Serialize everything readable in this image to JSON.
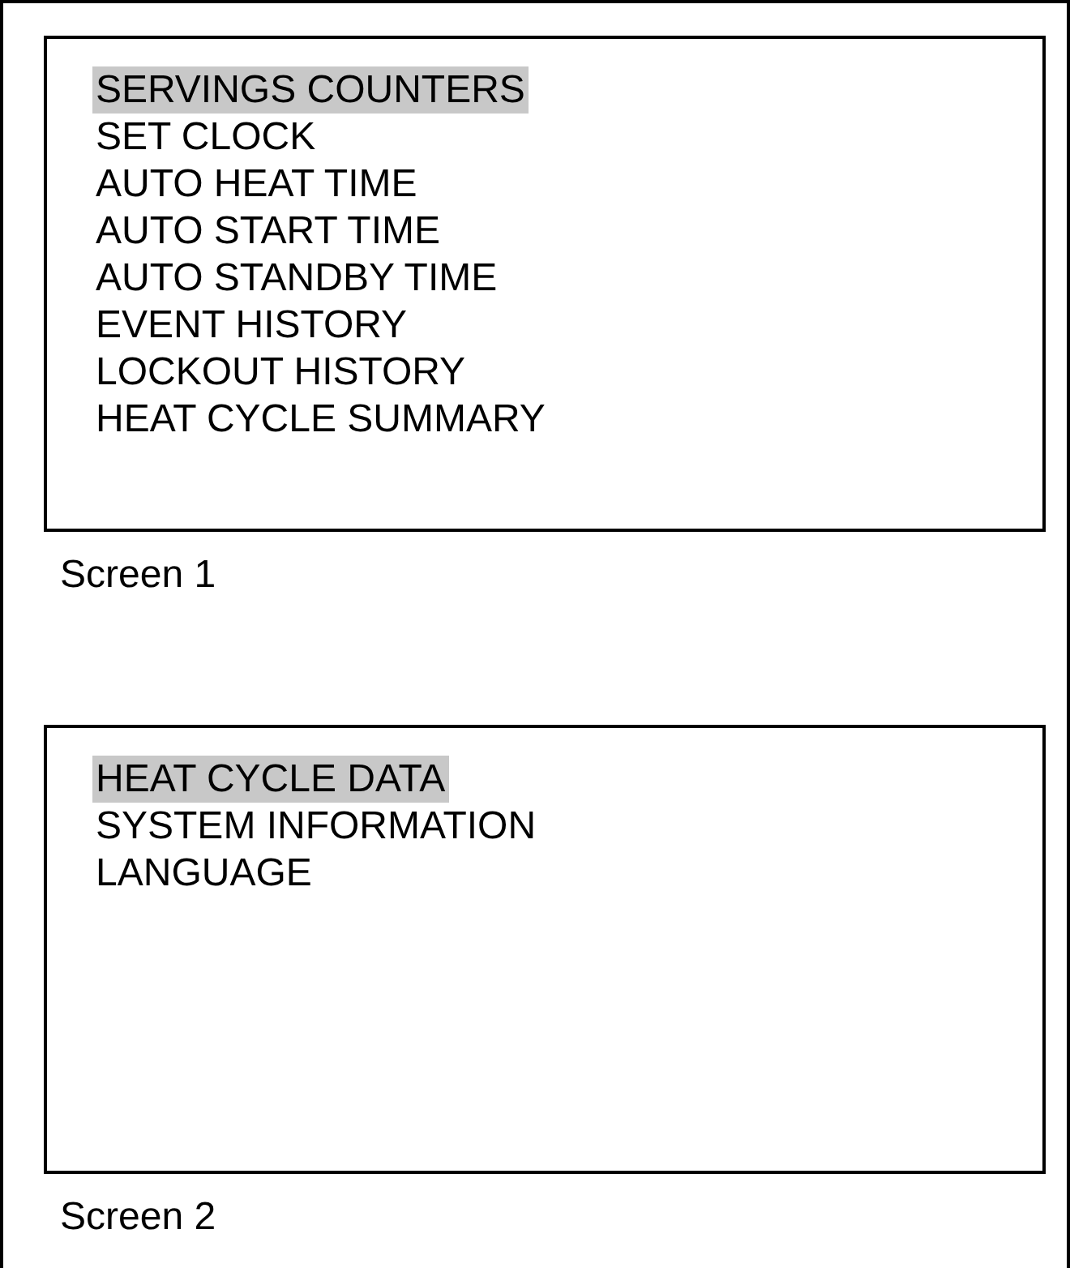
{
  "screens": [
    {
      "label": "Screen 1",
      "items": [
        {
          "text": "SERVINGS COUNTERS",
          "selected": true
        },
        {
          "text": "SET CLOCK",
          "selected": false
        },
        {
          "text": "AUTO HEAT TIME",
          "selected": false
        },
        {
          "text": "AUTO START TIME",
          "selected": false
        },
        {
          "text": "AUTO STANDBY TIME",
          "selected": false
        },
        {
          "text": "EVENT HISTORY",
          "selected": false
        },
        {
          "text": "LOCKOUT HISTORY",
          "selected": false
        },
        {
          "text": "HEAT CYCLE SUMMARY",
          "selected": false
        }
      ]
    },
    {
      "label": "Screen 2",
      "items": [
        {
          "text": "HEAT CYCLE DATA",
          "selected": true
        },
        {
          "text": "SYSTEM INFORMATION",
          "selected": false
        },
        {
          "text": "LANGUAGE",
          "selected": false
        }
      ]
    }
  ]
}
